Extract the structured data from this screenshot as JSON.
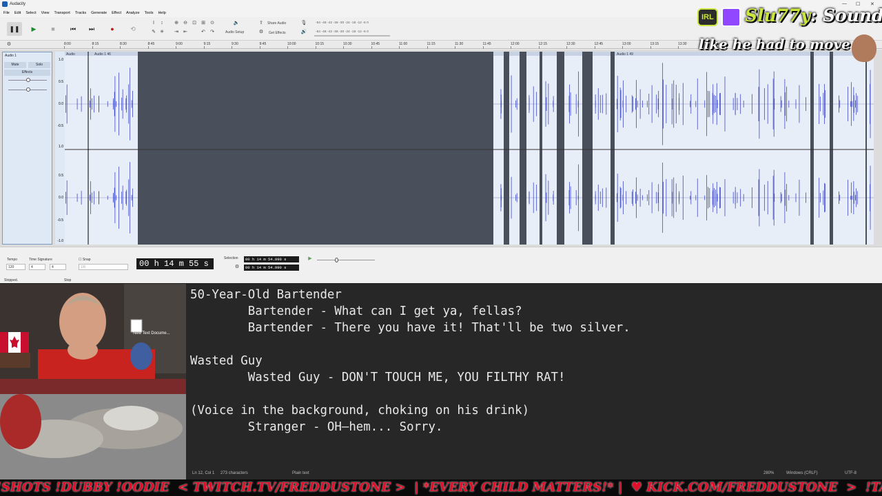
{
  "window": {
    "title": "Audacity"
  },
  "menu": [
    "File",
    "Edit",
    "Select",
    "View",
    "Transport",
    "Tracks",
    "Generate",
    "Effect",
    "Analyze",
    "Tools",
    "Help"
  ],
  "toolbar": {
    "audio_setup_label": "Audio Setup",
    "share_audio_label": "Share Audio",
    "get_effects_label": "Get Effects",
    "meter_ticks": "-54 -48 -42 -36 -30 -24 -18 -12 -6 0"
  },
  "ruler_ticks": [
    "8:00",
    "8:15",
    "8:30",
    "8:45",
    "9:00",
    "9:15",
    "9:30",
    "9:45",
    "10:00",
    "10:15",
    "10:30",
    "10:45",
    "11:00",
    "11:15",
    "11:30",
    "11:45",
    "12:00",
    "12:15",
    "12:30",
    "12:45",
    "13:00",
    "13:15",
    "13:30"
  ],
  "track": {
    "name": "Audio 1",
    "mute_label": "Mute",
    "solo_label": "Solo",
    "effects_label": "Effects",
    "scale": [
      "1.0",
      "0.5",
      "0.0",
      "-0.5",
      "-1.0"
    ],
    "clip_labels": [
      "Audio",
      "Audio 1 46",
      "Audio 1 49"
    ]
  },
  "status": {
    "tempo_label": "Tempo",
    "tempo_value": "120",
    "timesig_label": "Time Signature",
    "timesig_num": "4",
    "timesig_den": "4",
    "snap_label": "Snap",
    "snap_value": "1/8",
    "time_display": "00 h 14 m 55 s",
    "selection_label": "Selection",
    "sel_start": "00 h 14 m 54.990 s",
    "sel_end": "00 h 14 m 54.990 s",
    "state_left": "Stopped.",
    "state_right": "Stop"
  },
  "editor": {
    "lines": [
      "50-Year-Old Bartender",
      "        Bartender - What can I get ya, fellas?",
      "        Bartender - There you have it! That'll be two silver.",
      "",
      "Wasted Guy",
      "        Wasted Guy - DON'T TOUCH ME, YOU FILTHY RAT!",
      "",
      "(Voice in the background, choking on his drink)",
      "        Stranger - OH—hem... Sorry."
    ],
    "status_pos": "Ln 12, Col 1",
    "status_chars": "273 characters",
    "status_type": "Plain text",
    "status_zoom": "280%",
    "status_eol": "Windows (CRLF)",
    "status_enc": "UTF-8"
  },
  "desktop_icon_label": "New Text Docume...",
  "overlay": {
    "badge": "IRL",
    "title_part1": "Slu77y",
    "title_part2": ": Sounds",
    "subtitle": "like he had to move"
  },
  "ticker": "!SHOTS !DUBBY !OODIE  < TWITCH.TV/FREDDUSTONE >  | *EVERY CHILD MATTERS!* |  ♥ KICK.COM/FREDDUSTONE  >  !TANGIA !PLAY SONG"
}
